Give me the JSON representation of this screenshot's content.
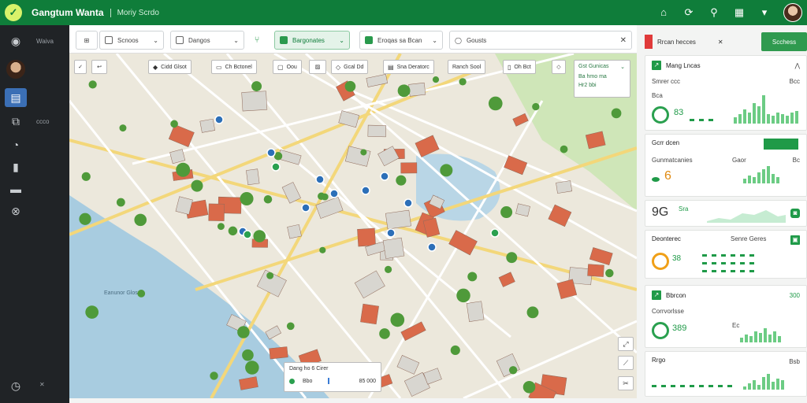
{
  "header": {
    "title": "Gangtum Wanta",
    "subtitle": "Moriy Scrdo"
  },
  "sidebar": {
    "rail_label_1": "Waiva",
    "rail_label_2": "ccco"
  },
  "toolbar": {
    "dropdown_1": "Scnoos",
    "dropdown_2": "Dangos",
    "dropdown_3": "Bargonates",
    "dropdown_4": "Eroqas sa Bcan",
    "search_value": "Gousts"
  },
  "map": {
    "chips": [
      "Cidd Glsot",
      "Ch Bctonel",
      "Oou",
      "Gcal Dd",
      "Sna Deratorc",
      "Ranch Sool",
      "Oh Bct"
    ],
    "popup": {
      "title": "Gst Gunicas",
      "line1": "Ba hmo ma",
      "line2": "Hr2 bbi"
    },
    "water_label": "Eanunor Glosa",
    "legend": {
      "title": "Dang ho 6 Cirer",
      "row1": "Bbo",
      "row2": "85 000"
    }
  },
  "panel": {
    "tab": "Rrcan hecces",
    "action": "Scchess",
    "cards": [
      {
        "title": "Mang Lncas",
        "label": "Smrer ccc",
        "kpi": "Bcc",
        "kpi2": "Bca",
        "big": "83"
      },
      {
        "title": "Gcrr dcen",
        "label": "Gunmatcanies",
        "kpi": "Bc",
        "kpi2": "Gaor",
        "big": "6"
      },
      {
        "title": "Sra",
        "label": "",
        "kpi": "9G",
        "kpi2": "",
        "big": ""
      },
      {
        "title": "Deonterec",
        "label": "",
        "kpi": "Senre Geres",
        "kpi2": "",
        "big": "38"
      },
      {
        "title": "Bbrcon",
        "label": "Corrvorlsse",
        "kpi": "300",
        "kpi2": "Ec",
        "big": "389"
      },
      {
        "title": "Rrgo",
        "label": "",
        "kpi": "Bsb",
        "kpi2": "",
        "big": ""
      }
    ]
  },
  "colors": {
    "brand": "#0f7d3a",
    "accent": "#2aa04f",
    "water": "#a8cce0",
    "roof": "#d96a4a"
  },
  "icons": [
    "check-logo-icon",
    "home-icon",
    "refresh-icon",
    "search-icon",
    "grid-icon",
    "bell-icon",
    "map-icon",
    "settings-icon",
    "layers-icon",
    "help-icon",
    "zoom-in-icon",
    "zoom-out-icon",
    "close-icon"
  ]
}
